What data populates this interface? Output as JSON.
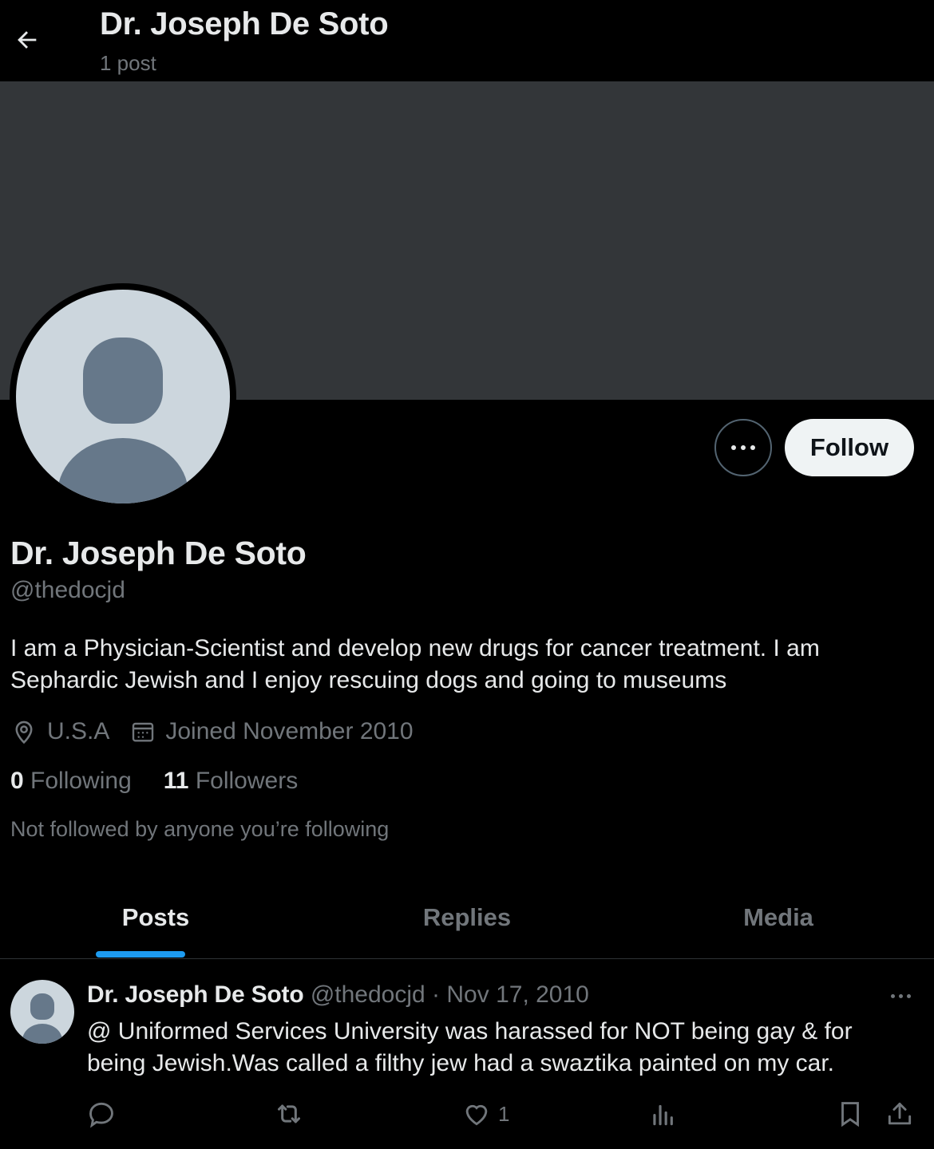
{
  "header": {
    "title": "Dr. Joseph De Soto",
    "post_count": "1 post"
  },
  "profile": {
    "name": "Dr. Joseph De Soto",
    "handle": "@thedocjd",
    "bio": "I am a Physician-Scientist and develop new drugs for cancer treatment. I am Sephardic Jewish and I enjoy rescuing dogs and going to museums",
    "location": "U.S.A",
    "joined": "Joined November 2010",
    "following_count": "0",
    "following_label": "Following",
    "followers_count": "11",
    "followers_label": "Followers",
    "not_followed": "Not followed by anyone you’re following",
    "follow_label": "Follow"
  },
  "tabs": [
    {
      "label": "Posts",
      "active": true
    },
    {
      "label": "Replies",
      "active": false
    },
    {
      "label": "Media",
      "active": false
    }
  ],
  "tweet": {
    "name": "Dr. Joseph De Soto",
    "handle": "@thedocjd",
    "separator": "·",
    "date": "Nov 17, 2010",
    "text": "@ Uniformed Services University was harassed for NOT being gay & for being Jewish.Was called a filthy jew had a swaztika painted on my car.",
    "likes": "1"
  },
  "colors": {
    "background": "#000000",
    "banner": "#333639",
    "accent": "#1d9bf0",
    "text_primary": "#e7e9ea",
    "text_secondary": "#71767b",
    "avatar_bg": "#ccd6dd",
    "avatar_fg": "#66788a"
  },
  "icons": [
    "back-arrow-icon",
    "more-dots-icon",
    "location-icon",
    "calendar-icon",
    "reply-icon",
    "repost-icon",
    "like-icon",
    "views-icon",
    "bookmark-icon",
    "share-icon"
  ]
}
